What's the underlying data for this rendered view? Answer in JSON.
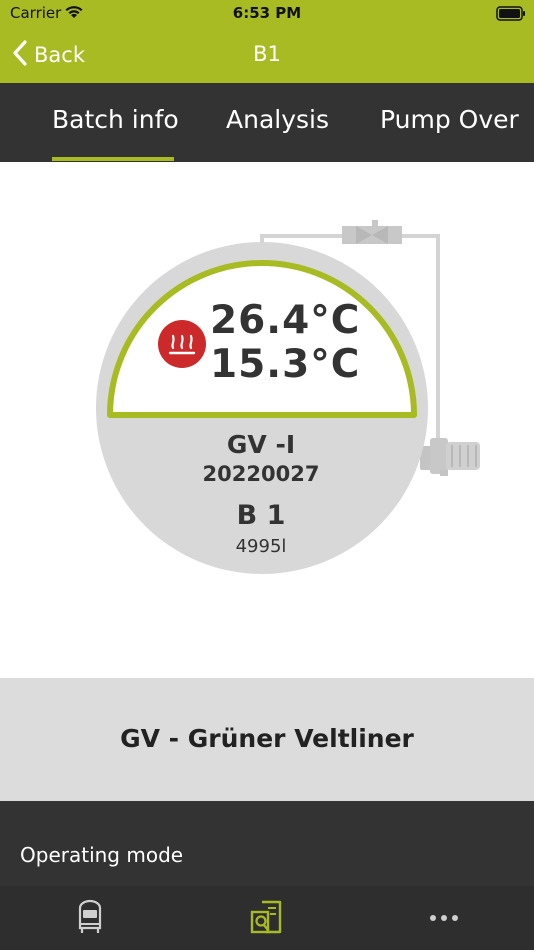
{
  "status_bar": {
    "carrier": "Carrier",
    "time": "6:53 PM"
  },
  "nav": {
    "back_label": "Back",
    "title": "B1"
  },
  "tabs": [
    {
      "label": "Batch info",
      "selected": true
    },
    {
      "label": "Analysis",
      "selected": false
    },
    {
      "label": "Pump Over",
      "selected": false
    }
  ],
  "tank": {
    "heating_icon": "heating-icon",
    "temperature_1": "26.4°C",
    "temperature_2": "15.3°C",
    "code": "GV -I",
    "batch_number": "20220027",
    "name": "B 1",
    "volume": "4995l"
  },
  "variety": {
    "label": "GV - Grüner Veltliner"
  },
  "operating_mode": {
    "label": "Operating mode"
  },
  "tab_bar": {
    "items": [
      "tank-icon",
      "document-search-icon",
      "more-icon"
    ]
  },
  "colors": {
    "accent": "#a9bb22",
    "dark": "#333333",
    "tank_gray": "#d8d8d8",
    "heat_red": "#cc2a2a"
  }
}
